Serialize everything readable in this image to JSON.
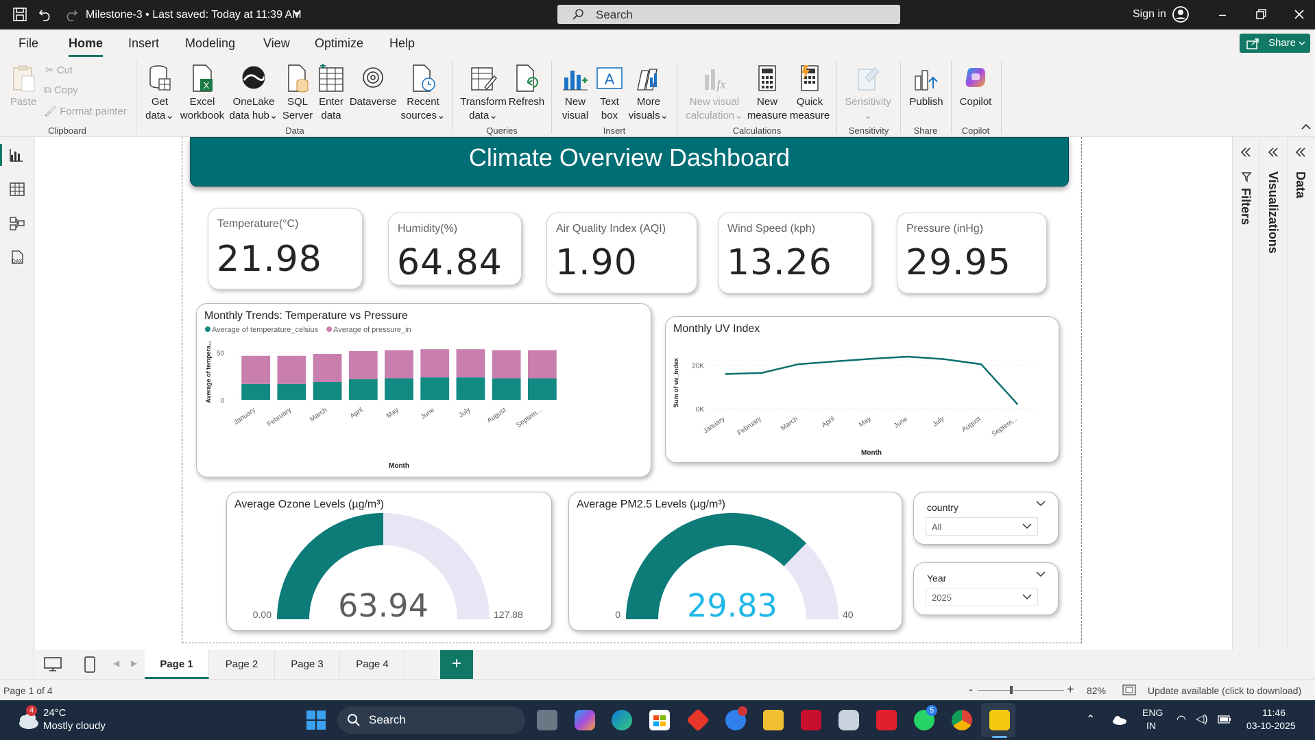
{
  "titlebar": {
    "doc_title": "Milestone-3 • Last saved: Today at 11:39 AM",
    "search_placeholder": "Search",
    "signin": "Sign in"
  },
  "menu": {
    "tabs": [
      "File",
      "Home",
      "Insert",
      "Modeling",
      "View",
      "Optimize",
      "Help"
    ],
    "active": "Home",
    "share": "Share"
  },
  "ribbon": {
    "clipboard": {
      "paste": "Paste",
      "cut": "Cut",
      "copy": "Copy",
      "format_painter": "Format painter",
      "label": "Clipboard"
    },
    "data": {
      "get_data": [
        "Get",
        "data"
      ],
      "excel": [
        "Excel",
        "workbook"
      ],
      "onelake": [
        "OneLake",
        "data hub"
      ],
      "sql": [
        "SQL",
        "Server"
      ],
      "enter": [
        "Enter",
        "data"
      ],
      "dataverse": [
        "Dataverse"
      ],
      "recent": [
        "Recent",
        "sources"
      ],
      "label": "Data"
    },
    "queries": {
      "transform": [
        "Transform",
        "data"
      ],
      "refresh": [
        "Refresh"
      ],
      "label": "Queries"
    },
    "insert": {
      "new_visual": [
        "New",
        "visual"
      ],
      "text_box": [
        "Text",
        "box"
      ],
      "more_visuals": [
        "More",
        "visuals"
      ],
      "label": "Insert"
    },
    "calculations": {
      "new_visual_calc": [
        "New visual",
        "calculation"
      ],
      "new_measure": [
        "New",
        "measure"
      ],
      "quick_measure": [
        "Quick",
        "measure"
      ],
      "label": "Calculations"
    },
    "sensitivity": {
      "btn": "Sensitivity",
      "label": "Sensitivity"
    },
    "share": {
      "publish": "Publish",
      "label": "Share"
    },
    "copilot": {
      "btn": "Copilot",
      "label": "Copilot"
    }
  },
  "dashboard": {
    "title": "Climate Overview Dashboard",
    "kpis": [
      {
        "label": "Temperature(°C)",
        "value": "21.98"
      },
      {
        "label": "Humidity(%)",
        "value": "64.84"
      },
      {
        "label": "Air Quality Index (AQI)",
        "value": "1.90"
      },
      {
        "label": "Wind Speed (kph)",
        "value": "13.26"
      },
      {
        "label": "Pressure (inHg)",
        "value": "29.95"
      }
    ],
    "slicers": [
      {
        "label": "country",
        "value": "All"
      },
      {
        "label": "Year",
        "value": "2025"
      }
    ]
  },
  "chart_data": [
    {
      "type": "bar",
      "stacked": true,
      "title": "Monthly Trends: Temperature vs Pressure",
      "categories": [
        "January",
        "February",
        "March",
        "April",
        "May",
        "June",
        "July",
        "August",
        "Septem..."
      ],
      "series": [
        {
          "name": "Average of temperature_celsius",
          "color": "#118a82",
          "values": [
            17,
            17,
            19,
            22,
            23,
            24,
            24,
            23,
            23
          ]
        },
        {
          "name": "Average of pressure_in",
          "color": "#c97fae",
          "values": [
            30,
            30,
            30,
            30,
            30,
            30,
            30,
            30,
            30
          ]
        }
      ],
      "xlabel": "Month",
      "ylabel": "Average of tempera...",
      "yticks": [
        "0",
        "50"
      ],
      "ylim": [
        0,
        60
      ],
      "legend": "top-left",
      "grid": true
    },
    {
      "type": "line",
      "title": "Monthly UV Index",
      "categories": [
        "January",
        "February",
        "March",
        "April",
        "May",
        "June",
        "July",
        "August",
        "Septem..."
      ],
      "series": [
        {
          "name": "Sum of uv_index",
          "color": "#0a6f6e",
          "values": [
            16000,
            16500,
            20500,
            21800,
            23000,
            24000,
            22800,
            20500,
            2000
          ]
        }
      ],
      "xlabel": "Month",
      "ylabel": "Sum of uv_index",
      "yticks": [
        "0K",
        "20K"
      ],
      "ylim": [
        0,
        24000
      ],
      "grid": true
    },
    {
      "type": "gauge",
      "title": "Average Ozone Levels (µg/m³)",
      "value": 63.94,
      "value_label": "63.94",
      "min": 0,
      "max": 127.88,
      "min_label": "0.00",
      "max_label": "127.88",
      "fill_color": "#0d7c78",
      "track_color": "#e8e6f5",
      "value_color": "#605e5c"
    },
    {
      "type": "gauge",
      "title": "Average PM2.5 Levels (µg/m³)",
      "value": 29.83,
      "value_label": "29.83",
      "min": 0,
      "max": 40,
      "min_label": "0",
      "max_label": "40",
      "fill_color": "#0d7c78",
      "track_color": "#e8e6f5",
      "value_color": "#20b8e8"
    }
  ],
  "panes": {
    "filters": "Filters",
    "visualizations": "Visualizations",
    "data": "Data"
  },
  "pages": {
    "tabs": [
      "Page 1",
      "Page 2",
      "Page 3",
      "Page 4"
    ],
    "active": "Page 1",
    "add": "+"
  },
  "status": {
    "page": "Page 1 of 4",
    "zoom": "82%",
    "update": "Update available (click to download)"
  },
  "taskbar": {
    "weather_temp": "24°C",
    "weather_desc": "Mostly cloudy",
    "weather_badge": "4",
    "search": "Search",
    "whatsapp_badge": "5",
    "lang_1": "ENG",
    "lang_2": "IN",
    "time": "11:46",
    "date": "03-10-2025"
  },
  "colors": {
    "accent": "#117865",
    "banner": "#006e75",
    "taskbar": "#1c2b3f",
    "titlebar": "#1f1f1f"
  }
}
